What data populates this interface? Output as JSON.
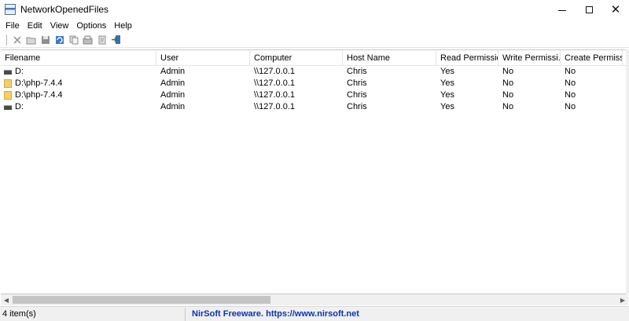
{
  "window": {
    "title": "NetworkOpenedFiles",
    "controls": {
      "minimize": "—",
      "maximize": "☐",
      "close": "✕"
    }
  },
  "menu": [
    "File",
    "Edit",
    "View",
    "Options",
    "Help"
  ],
  "toolbar": {
    "buttons": [
      "delete-icon",
      "open-folder-icon",
      "save-icon",
      "refresh-icon",
      "copy-icon",
      "properties-icon",
      "html-report-icon",
      "exit-icon"
    ]
  },
  "table": {
    "columns": [
      "Filename",
      "User",
      "Computer",
      "Host Name",
      "Read Permission",
      "Write Permissi...",
      "Create Permiss..."
    ],
    "rows": [
      {
        "icon": "drive",
        "cells": [
          "D:",
          "Admin",
          "\\\\127.0.0.1",
          "Chris",
          "Yes",
          "No",
          "No"
        ]
      },
      {
        "icon": "folder",
        "cells": [
          "D:\\php-7.4.4",
          "Admin",
          "\\\\127.0.0.1",
          "Chris",
          "Yes",
          "No",
          "No"
        ]
      },
      {
        "icon": "folder",
        "cells": [
          "D:\\php-7.4.4",
          "Admin",
          "\\\\127.0.0.1",
          "Chris",
          "Yes",
          "No",
          "No"
        ]
      },
      {
        "icon": "drive",
        "cells": [
          "D:",
          "Admin",
          "\\\\127.0.0.1",
          "Chris",
          "Yes",
          "No",
          "No"
        ]
      }
    ]
  },
  "statusbar": {
    "count": "4 item(s)",
    "link": "NirSoft Freeware.  https://www.nirsoft.net"
  },
  "colors": {
    "link": "#0b33b8",
    "folder": "#f3cf6a"
  }
}
